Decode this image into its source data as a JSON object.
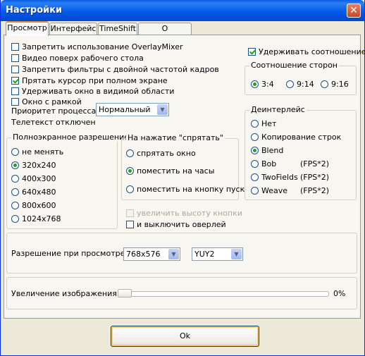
{
  "window": {
    "title": "Настройки",
    "close_glyph": "✕"
  },
  "tabs": [
    {
      "label": "Просмотр",
      "active": true
    },
    {
      "label": "Интерфейс",
      "active": false
    },
    {
      "label": "TimeShift",
      "active": false
    },
    {
      "label": "О программе",
      "active": false
    }
  ],
  "general": {
    "checkboxes": [
      {
        "label": "Запретить использование OverlayMixer",
        "checked": false
      },
      {
        "label": "Видео поверх рабочего стола",
        "checked": false
      },
      {
        "label": "Запретить фильтры с двойной частотой кадров",
        "checked": false
      },
      {
        "label": "Прятать курсор при полном экране",
        "checked": true
      },
      {
        "label": "Удерживать окно в видимой области",
        "checked": false
      },
      {
        "label": "Окно с рамкой",
        "checked": false
      }
    ],
    "priority_label": "Приоритет процесса",
    "priority_value": "Нормальный",
    "teletext_status": "Телетекст отключен"
  },
  "keep_aspect": {
    "label": "Удерживать соотношение",
    "checked": true
  },
  "aspect_ratio": {
    "title": "Соотношение сторон",
    "options": [
      {
        "label": "3:4",
        "checked": true
      },
      {
        "label": "9:14",
        "checked": false
      },
      {
        "label": "9:16",
        "checked": false
      }
    ]
  },
  "deinterlace": {
    "title": "Деинтерлейс",
    "options": [
      {
        "label": "Нет",
        "note": "",
        "checked": false
      },
      {
        "label": "Копирование строк",
        "note": "",
        "checked": false
      },
      {
        "label": "Blend",
        "note": "",
        "checked": true
      },
      {
        "label": "Bob",
        "note": "(FPS*2)",
        "checked": false
      },
      {
        "label": "TwoFields",
        "note": "(FPS*2)",
        "checked": false
      },
      {
        "label": "Weave",
        "note": "(FPS*2)",
        "checked": false
      }
    ]
  },
  "fullscreen_res": {
    "title": "Полноэкранное разрешение",
    "options": [
      {
        "label": "не менять",
        "checked": false
      },
      {
        "label": "320x240",
        "checked": true
      },
      {
        "label": "400x300",
        "checked": false
      },
      {
        "label": "640x480",
        "checked": false
      },
      {
        "label": "800x600",
        "checked": false
      },
      {
        "label": "1024x768",
        "checked": false
      }
    ]
  },
  "hide_action": {
    "title": "На нажатие \"спрятать\"",
    "options": [
      {
        "label": "спрятать окно",
        "checked": false
      },
      {
        "label": "поместить на часы",
        "checked": true
      },
      {
        "label": "поместить на кнопку пуск",
        "checked": false
      }
    ]
  },
  "extra": {
    "increase_button_height": {
      "label": "увеличить высоту кнопки",
      "checked": false,
      "disabled": true
    },
    "disable_overlay": {
      "label": "и выключить оверлей",
      "checked": false
    }
  },
  "view_resolution": {
    "label": "Разрешение при просмотре",
    "resolution": "768x576",
    "format": "YUY2"
  },
  "zoom": {
    "label": "Увеличение изображения",
    "value_text": "0%",
    "value": 0
  },
  "ok_button": {
    "label": "Ok"
  }
}
